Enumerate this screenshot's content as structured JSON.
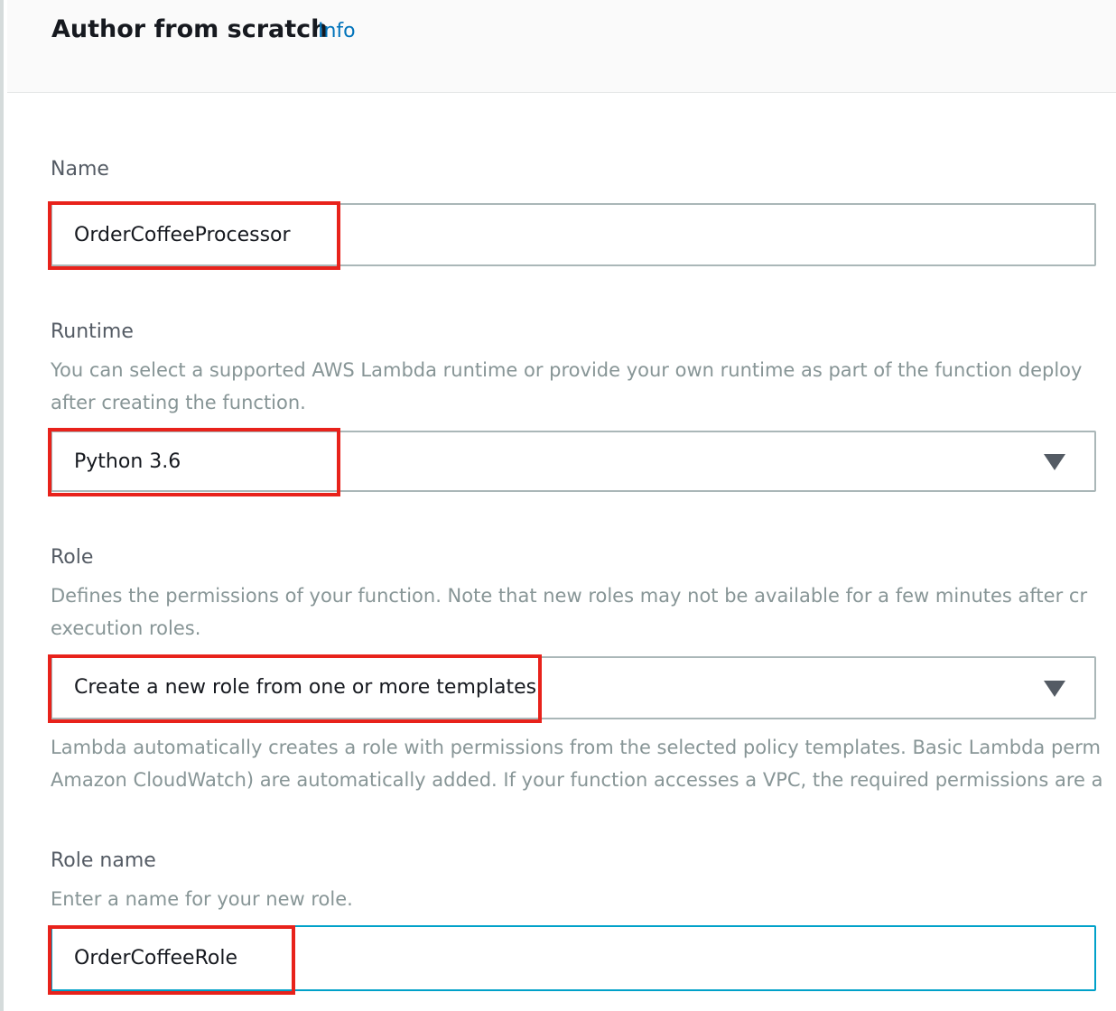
{
  "header": {
    "title": "Author from scratch",
    "info_link": "Info"
  },
  "name": {
    "label": "Name",
    "value": "OrderCoffeeProcessor"
  },
  "runtime": {
    "label": "Runtime",
    "description_line1": "You can select a supported AWS Lambda runtime or provide your own runtime as part of the function deploy",
    "description_line2": "after creating the function.",
    "selected": "Python 3.6",
    "icon": "caret-down-icon"
  },
  "role": {
    "label": "Role",
    "description_line1": "Defines the permissions of your function. Note that new roles may not be available for a few minutes after cr",
    "description_line2": "execution roles.",
    "selected": "Create a new role from one or more templates.",
    "icon": "caret-down-icon",
    "help_line1": "Lambda automatically creates a role with permissions from the selected policy templates. Basic Lambda perm",
    "help_line2": "Amazon CloudWatch) are automatically added. If your function accesses a VPC, the required permissions are a"
  },
  "role_name": {
    "label": "Role name",
    "description": "Enter a name for your new role.",
    "value": "OrderCoffeeRole"
  },
  "colors": {
    "link": "#0073bb",
    "highlight": "#e8221b",
    "focus_border": "#00a1c9"
  }
}
